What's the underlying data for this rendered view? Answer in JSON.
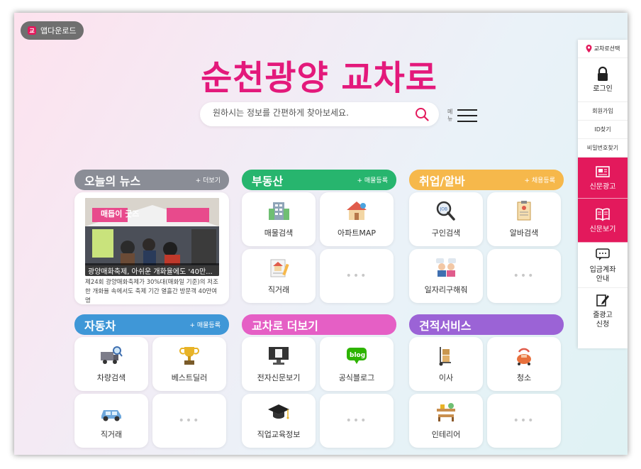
{
  "app_download": {
    "label": "앱다운로드",
    "logo": "교"
  },
  "title": "순천광양 교차로",
  "search": {
    "placeholder": "원하시는 정보를 간편하게 찾아보세요."
  },
  "menu": {
    "label": "메뉴"
  },
  "sidebar": {
    "location": "교차로선택",
    "login": "로그인",
    "signup": "회원가입",
    "find_id": "ID찾기",
    "find_pw": "비밀번호찾기",
    "newspaper_ad": "신문광고",
    "newspaper_view": "신문보기",
    "deposit_line1": "입금계좌",
    "deposit_line2": "안내",
    "line_ad_line1": "줄광고",
    "line_ad_line2": "신청"
  },
  "sections": {
    "news": {
      "title": "오늘의 뉴스",
      "more": "+ 더보기",
      "photo_sign": "매듭이 굿즈샵",
      "caption": "광양매화축제, 아쉬운 개화율에도 '40만...",
      "body": "제24회 광양매화축제가 30%대(매화일 기준)의 저조한 개화율 속에서도 축제 기간 열흘간 방문객 40만여 명"
    },
    "realestate": {
      "title": "부동산",
      "more": "+ 매물등록",
      "tiles": [
        "매물검색",
        "아파트MAP",
        "직거래",
        "•••"
      ]
    },
    "jobs": {
      "title": "취업/알바",
      "more": "+ 채용등록",
      "tiles": [
        "구인검색",
        "알바검색",
        "일자리구해줘",
        "•••"
      ]
    },
    "cars": {
      "title": "자동차",
      "more": "+ 매물등록",
      "tiles": [
        "차량검색",
        "베스트딜러",
        "직거래",
        "•••"
      ]
    },
    "more": {
      "title": "교차로 더보기",
      "tiles": [
        "전자신문보기",
        "공식블로그",
        "직업교육정보",
        "•••"
      ],
      "blog_text": "blog"
    },
    "estimate": {
      "title": "견적서비스",
      "tiles": [
        "이사",
        "청소",
        "인테리어",
        "•••"
      ]
    }
  },
  "colors": {
    "accent": "#e3197b",
    "news": "#8a8d96",
    "realestate": "#27b56e",
    "jobs": "#f6b84b",
    "cars": "#3f97d7",
    "more": "#e55fc5",
    "estimate": "#9b63d6",
    "sidebar_red": "#e3195c"
  }
}
